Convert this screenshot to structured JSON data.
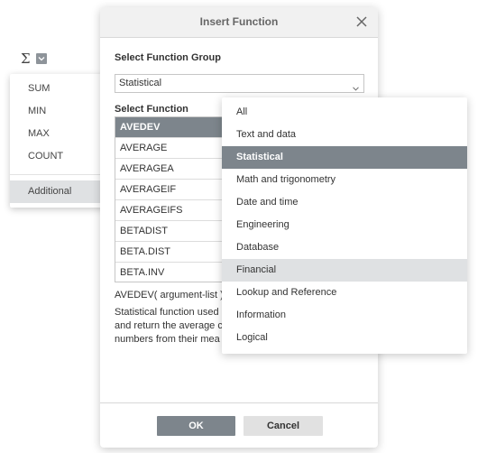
{
  "toolbar": {
    "sum_symbol": "Σ"
  },
  "sum_menu": {
    "items": [
      "SUM",
      "MIN",
      "MAX",
      "COUNT"
    ],
    "additional": "Additional"
  },
  "dialog": {
    "title": "Insert Function",
    "group_label": "Select Function Group",
    "group_value": "Statistical",
    "function_label": "Select Function",
    "functions": [
      "AVEDEV",
      "AVERAGE",
      "AVERAGEA",
      "AVERAGEIF",
      "AVERAGEIFS",
      "BETADIST",
      "BETA.DIST",
      "BETA.INV"
    ],
    "syntax": "AVEDEV( argument-list )",
    "description_lines": [
      "Statistical function used",
      "and return the average c",
      "numbers from their mea"
    ],
    "ok_label": "OK",
    "cancel_label": "Cancel"
  },
  "group_menu": {
    "items": [
      "All",
      "Text and data",
      "Statistical",
      "Math and trigonometry",
      "Date and time",
      "Engineering",
      "Database",
      "Financial",
      "Lookup and Reference",
      "Information",
      "Logical"
    ],
    "selected": "Statistical",
    "hovered": "Financial"
  },
  "colors": {
    "accent": "#7d858c",
    "hover": "#dfe1e3",
    "header": "#f1f1f1"
  }
}
